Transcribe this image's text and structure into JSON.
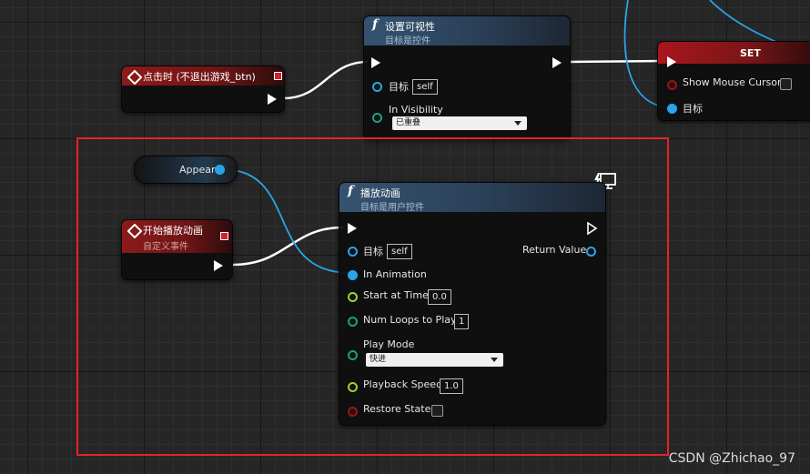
{
  "set_visibility_node": {
    "title": "设置可视性",
    "subtitle": "目标是控件",
    "target_label": "目标",
    "target_value": "self",
    "visibility_label": "In Visibility",
    "visibility_value": "已重叠"
  },
  "on_clicked_event": {
    "title": "点击时 (不退出游戏_btn)"
  },
  "set_node": {
    "title": "SET",
    "show_mouse_label": "Show Mouse Cursor",
    "target_label": "目标"
  },
  "appear_variable": {
    "label": "Appear"
  },
  "custom_event": {
    "title": "开始播放动画",
    "subtitle": "自定义事件"
  },
  "play_animation_node": {
    "title": "播放动画",
    "subtitle": "目标是用户控件",
    "target_label": "目标",
    "target_value": "self",
    "return_label": "Return Value",
    "in_animation_label": "In Animation",
    "start_time_label": "Start at Time",
    "start_time_value": "0.0",
    "loops_label": "Num Loops to Play",
    "loops_value": "1",
    "play_mode_label": "Play Mode",
    "play_mode_value": "快进",
    "speed_label": "Playback Speed",
    "speed_value": "1.0",
    "restore_label": "Restore State"
  },
  "watermark": "CSDN @Zhichao_97",
  "colors": {
    "exec_wire": "#ffffff",
    "object_pin": "#2aa4e8",
    "float_pin": "#9fd426",
    "int_pin": "#1a9f86",
    "bool_pin": "#8a1a1a",
    "selection_box": "#e5232a"
  },
  "icons": [
    "function-icon",
    "event-diamond-icon",
    "monitor-lightning-icon",
    "dropdown-arrow-icon"
  ]
}
